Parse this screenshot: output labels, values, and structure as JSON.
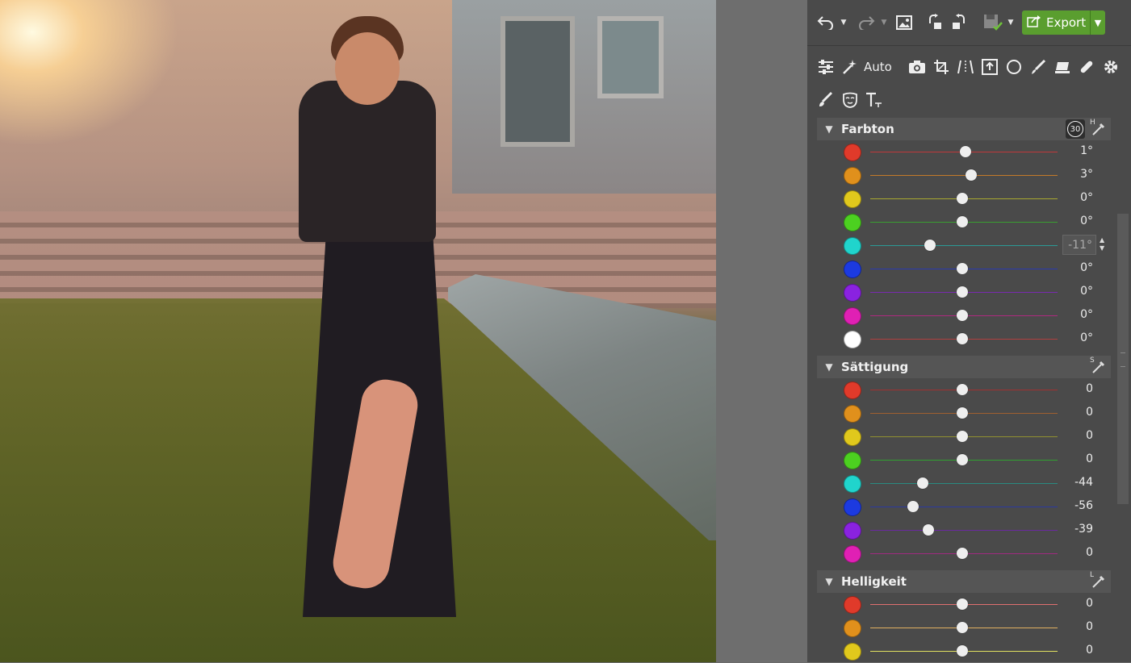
{
  "toolbar": {
    "undo_icon": "undo-icon",
    "redo_icon": "redo-icon",
    "image_icon": "image-icon",
    "rotate_left_icon": "rotate-left-icon",
    "rotate_right_icon": "rotate-right-icon",
    "save_icon": "save-icon",
    "export_label": "Export",
    "export_color": "#5a9e2f"
  },
  "tools": {
    "auto_label": "Auto"
  },
  "sections": {
    "hue": {
      "title": "Farbton",
      "badge": "30",
      "picker_letter": "H",
      "rows": [
        {
          "color": "#e03a2a",
          "value": "1°",
          "level": 0.51,
          "track": "#c0383a"
        },
        {
          "color": "#e0901c",
          "value": "3°",
          "level": 0.54,
          "track": "#c47a2a"
        },
        {
          "color": "#e0c81c",
          "value": "0°",
          "level": 0.49,
          "track": "#a8a830"
        },
        {
          "color": "#4cd020",
          "value": "0°",
          "level": 0.49,
          "track": "#3aa030"
        },
        {
          "color": "#20d4cc",
          "value": "-11°",
          "level": 0.32,
          "track": "#2a9a96",
          "editing": true
        },
        {
          "color": "#1c3ae0",
          "value": "0°",
          "level": 0.49,
          "track": "#2a3ab0"
        },
        {
          "color": "#8a22e0",
          "value": "0°",
          "level": 0.49,
          "track": "#7a2ab0"
        },
        {
          "color": "#e020b4",
          "value": "0°",
          "level": 0.49,
          "track": "#b02a80"
        },
        {
          "color": "#ffffff",
          "value": "0°",
          "level": 0.49,
          "track": "#b04040"
        }
      ]
    },
    "saturation": {
      "title": "Sättigung",
      "picker_letter": "S",
      "rows": [
        {
          "color": "#e03a2a",
          "value": "0",
          "level": 0.49,
          "track": "#a03030"
        },
        {
          "color": "#e0901c",
          "value": "0",
          "level": 0.49,
          "track": "#a06030"
        },
        {
          "color": "#e0c81c",
          "value": "0",
          "level": 0.49,
          "track": "#909030"
        },
        {
          "color": "#4cd020",
          "value": "0",
          "level": 0.49,
          "track": "#30a030"
        },
        {
          "color": "#20d4cc",
          "value": "-44",
          "level": 0.28,
          "track": "#2a8a80"
        },
        {
          "color": "#1c3ae0",
          "value": "-56",
          "level": 0.23,
          "track": "#2a3aa0"
        },
        {
          "color": "#8a22e0",
          "value": "-39",
          "level": 0.31,
          "track": "#6a2aa0"
        },
        {
          "color": "#e020b4",
          "value": "0",
          "level": 0.49,
          "track": "#a02a80"
        }
      ]
    },
    "lightness": {
      "title": "Helligkeit",
      "picker_letter": "L",
      "rows": [
        {
          "color": "#e03a2a",
          "value": "0",
          "level": 0.49,
          "track": "#e07070"
        },
        {
          "color": "#e0901c",
          "value": "0",
          "level": 0.49,
          "track": "#e0b060"
        },
        {
          "color": "#e0c81c",
          "value": "0",
          "level": 0.49,
          "track": "#e0e060"
        }
      ]
    }
  }
}
